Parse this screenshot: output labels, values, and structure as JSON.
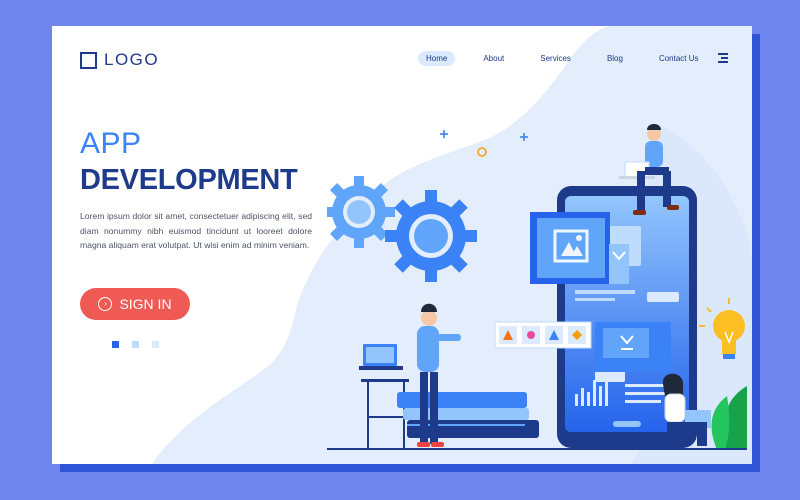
{
  "logo": {
    "text": "LOGO"
  },
  "nav": {
    "items": [
      "Home",
      "About",
      "Services",
      "Blog",
      "Contact Us"
    ],
    "active": "Home"
  },
  "hero": {
    "title_line1": "APP",
    "title_line2": "DEVELOPMENT",
    "body": "Lorem ipsum dolor sit amet, consectetuer adipiscing elit, sed diam nonummy nibh euismod tincidunt ut looreet dolore magna aliquam erat volutpat. Ut wisi enim ad minim veniam.",
    "button_label": "SIGN IN"
  },
  "pagination": {
    "count": 3,
    "active_index": 0
  },
  "colors": {
    "page_bg": "#6f86ee",
    "card_shadow": "#2f55d6",
    "primary_dark": "#1e3a8a",
    "primary": "#3b82f6",
    "accent_button": "#ef5a55",
    "blob": "#e3edfc",
    "bulb": "#fbbf24",
    "leaf": "#22c55e"
  },
  "icons": [
    "logo-square-icon",
    "hamburger-menu-icon",
    "sign-in-arrow-icon",
    "gear-icon",
    "image-icon",
    "download-icon",
    "bar-chart-icon",
    "lightbulb-icon",
    "laptop-icon",
    "plus-icon"
  ]
}
